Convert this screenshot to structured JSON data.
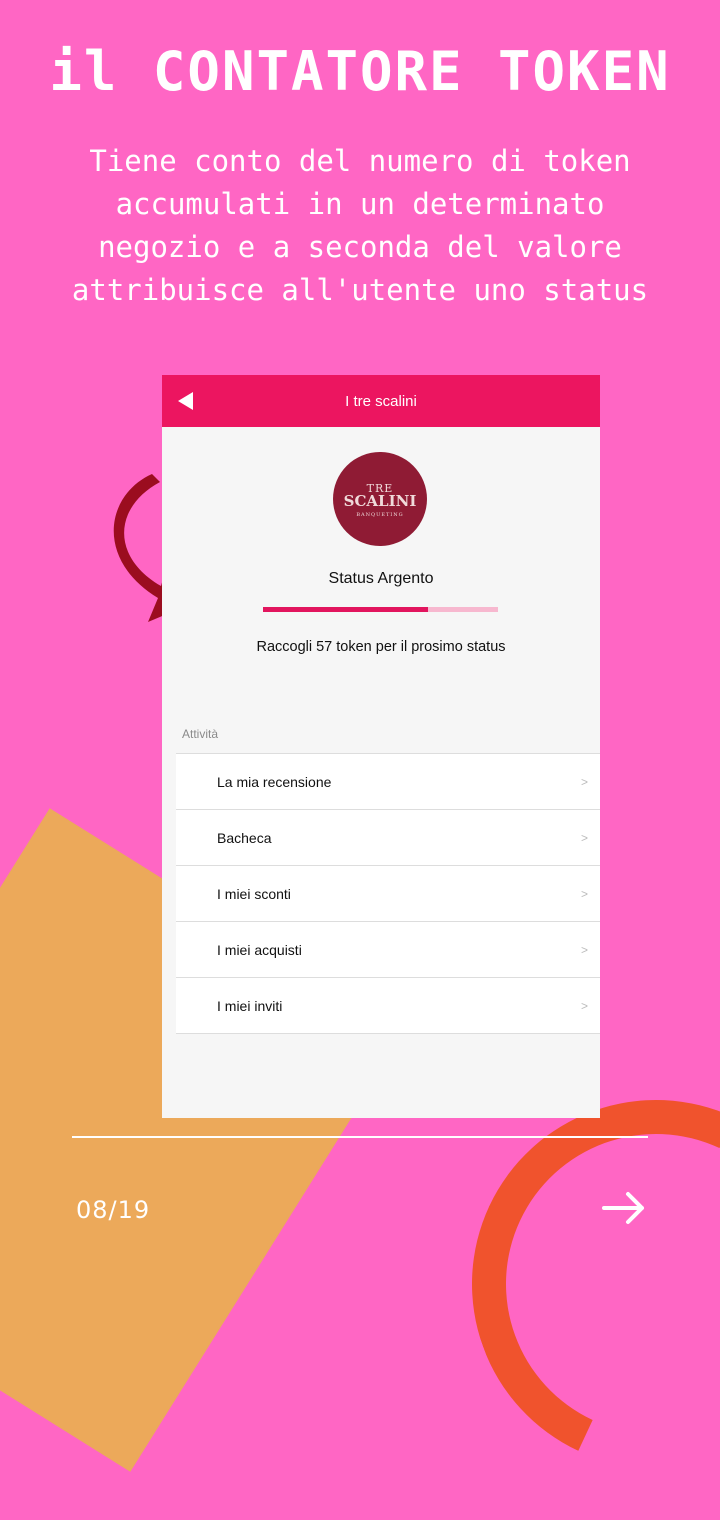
{
  "headline": "il CONTATORE TOKEN",
  "subtitle": "Tiene conto del numero di token accumulati in un determinato negozio e a seconda del valore attribuisce all'utente uno status",
  "app": {
    "title": "I tre scalini",
    "logo": {
      "line1": "TRE",
      "line2": "SCALINI",
      "line3": "BANQUETING"
    },
    "status": "Status Argento",
    "progress": 0.7,
    "tokens_message": "Raccogli 57 token per il prosimo status",
    "section_label": "Attività",
    "menu": [
      {
        "label": "La mia recensione"
      },
      {
        "label": "Bacheca"
      },
      {
        "label": "I miei sconti"
      },
      {
        "label": "I miei acquisti"
      },
      {
        "label": "I miei inviti"
      }
    ],
    "chevron": ">"
  },
  "page_number": "08/19",
  "colors": {
    "background": "#ff66c4",
    "appbar": "#ec1560",
    "progress": "#e2155e",
    "logo": "#8f1b34",
    "arrow": "#9b0d1f"
  }
}
